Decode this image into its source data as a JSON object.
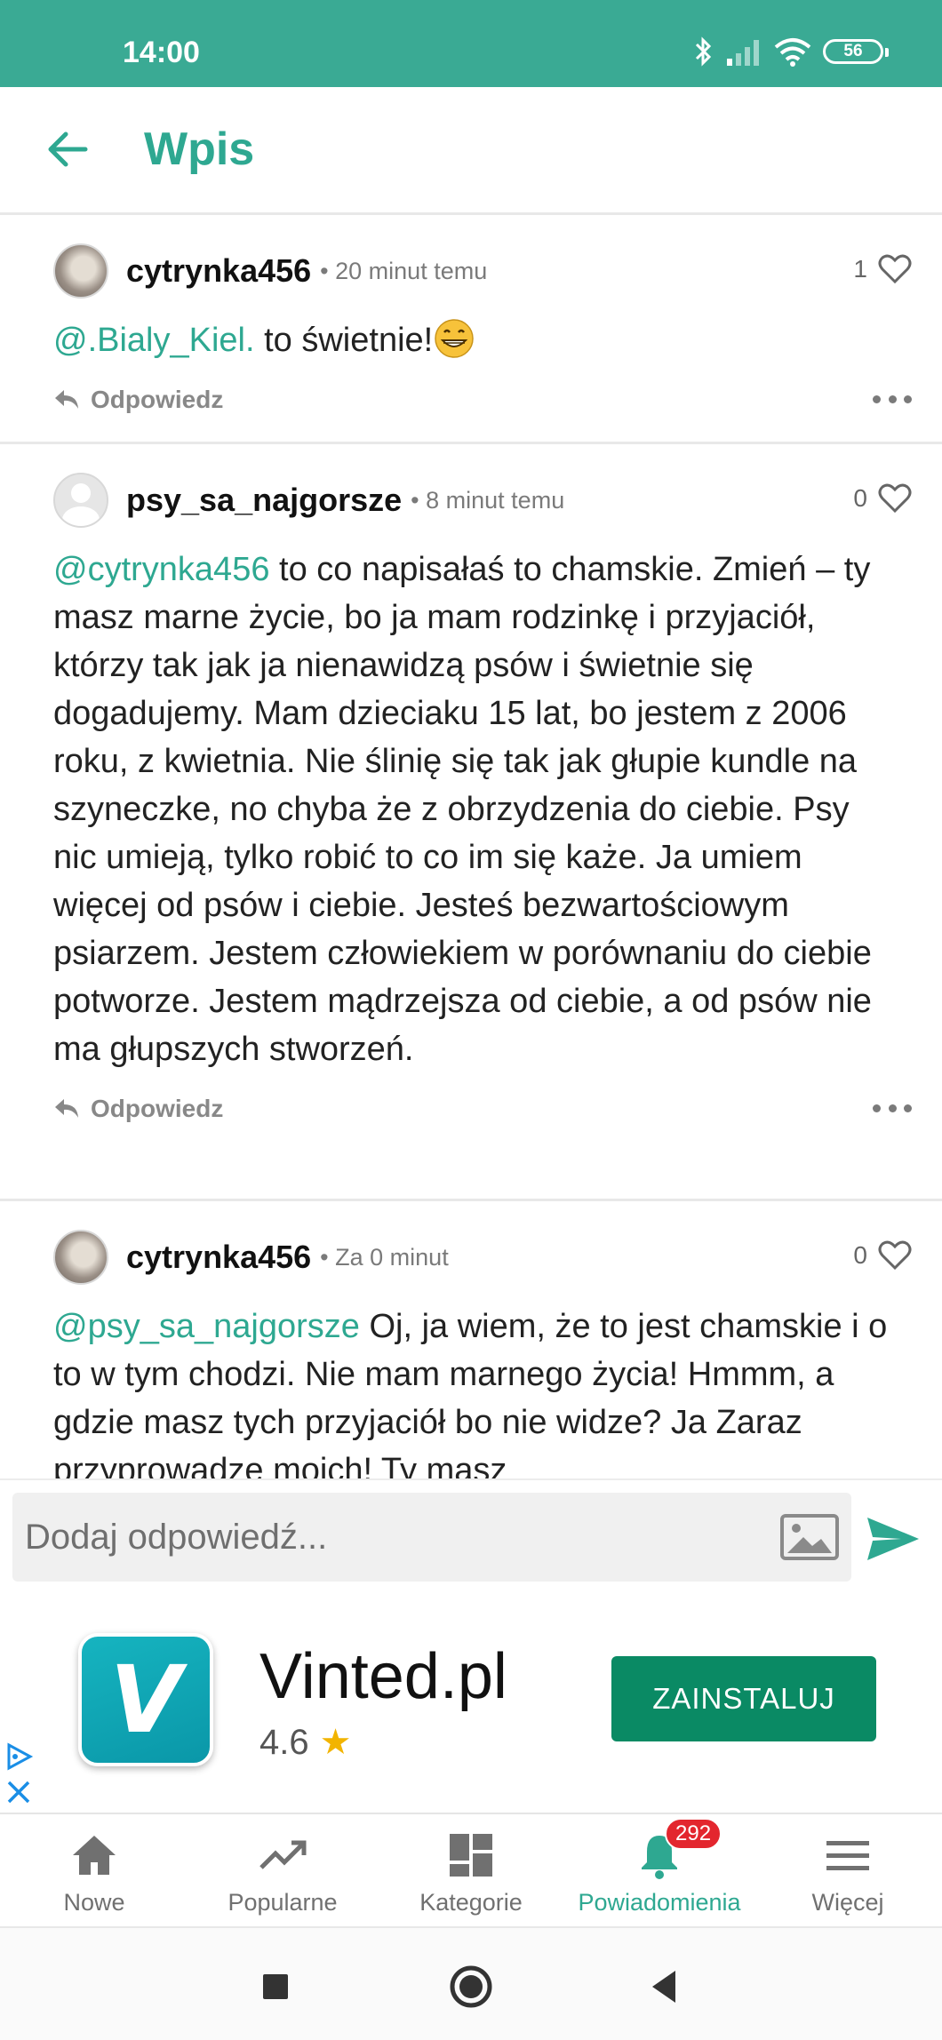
{
  "status_bar": {
    "time": "14:00",
    "battery": "56"
  },
  "app_bar": {
    "title": "Wpis"
  },
  "comments": [
    {
      "username": "cytrynka456",
      "time": "20 minut temu",
      "likes": "1",
      "mention": "@.Bialy_Kiel.",
      "text": " to świetnie!",
      "reply": "Odpowiedz"
    },
    {
      "username": "psy_sa_najgorsze",
      "time": "8 minut temu",
      "likes": "0",
      "mention": "@cytrynka456",
      "text": " to co napisałaś to chamskie. Zmień – ty masz marne życie, bo ja mam rodzinkę i przyjaciół, którzy tak jak ja nienawidzą psów i świetnie się dogadujemy. Mam dzieciaku 15 lat, bo jestem z 2006 roku, z kwietnia. Nie ślinię się tak jak głupie kundle na szyneczke, no chyba że z obrzydzenia do ciebie. Psy nic umieją, tylko robić to co im się każe. Ja umiem więcej od psów i ciebie. Jesteś bezwartościowym psiarzem. Jestem człowiekiem w porównaniu do ciebie potworze. Jestem mądrzejsza od ciebie, a od psów nie ma głupszych stworzeń.",
      "reply": "Odpowiedz"
    },
    {
      "username": "cytrynka456",
      "time": "Za 0 minut",
      "likes": "0",
      "mention": "@psy_sa_najgorsze",
      "text": " Oj, ja wiem, że to jest chamskie i o to w tym chodzi. Nie mam marnego życia! Hmmm, a gdzie masz tych przyjaciół bo nie widze? Ja Zaraz przyprowadze moich! Ty masz"
    }
  ],
  "reply_input": {
    "placeholder": "Dodaj odpowiedź..."
  },
  "ad": {
    "title": "Vinted.pl",
    "rating": "4.6",
    "install_label": "ZAINSTALUJ",
    "icon_letter": "V"
  },
  "bottom_nav": [
    {
      "label": "Nowe",
      "icon": "home-icon"
    },
    {
      "label": "Popularne",
      "icon": "trending-icon"
    },
    {
      "label": "Kategorie",
      "icon": "dashboard-icon"
    },
    {
      "label": "Powiadomienia",
      "icon": "bell-icon",
      "badge": "292",
      "active": true
    },
    {
      "label": "Więcej",
      "icon": "menu-icon"
    }
  ],
  "colors": {
    "accent": "#2ea891",
    "status_bar": "#3aaa94",
    "install": "#0a8a64",
    "badge": "#e3262e"
  }
}
